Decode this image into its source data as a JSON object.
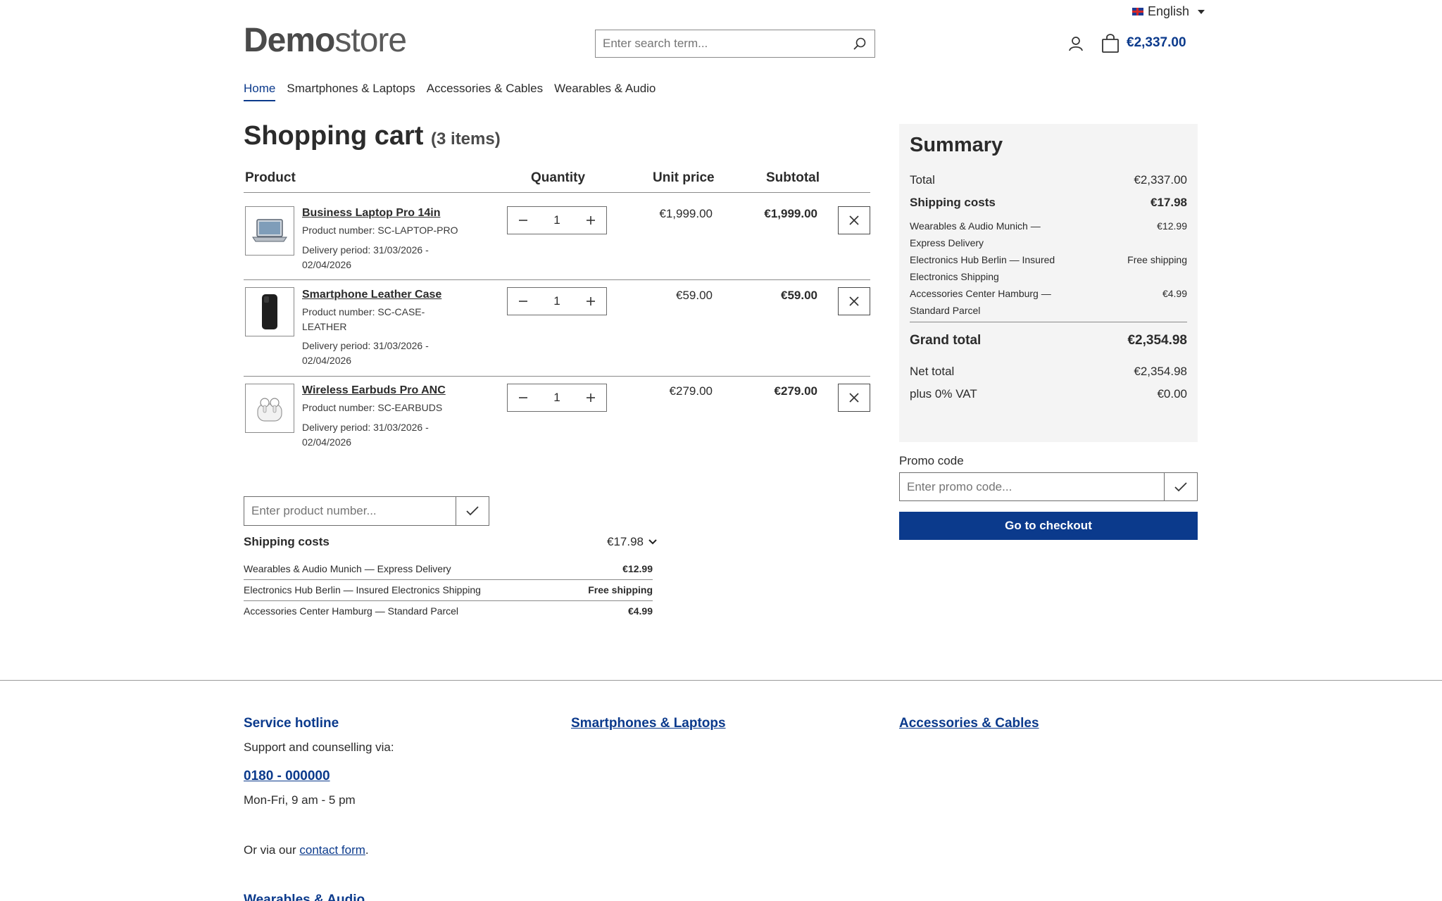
{
  "header": {
    "language": "English",
    "logo_bold": "Demo",
    "logo_light": "store",
    "search_placeholder": "Enter search term...",
    "cart_total": "€2,337.00"
  },
  "nav": {
    "items": [
      "Home",
      "Smartphones & Laptops",
      "Accessories & Cables",
      "Wearables & Audio"
    ]
  },
  "cart": {
    "title": "Shopping cart",
    "count": "(3 items)",
    "columns": {
      "product": "Product",
      "quantity": "Quantity",
      "unit_price": "Unit price",
      "subtotal": "Subtotal"
    },
    "items": [
      {
        "name": "Business Laptop Pro 14in",
        "product_number": "Product number: SC-LAPTOP-PRO",
        "delivery": "Delivery period: 31/03/2026 - 02/04/2026",
        "quantity": "1",
        "unit_price": "€1,999.00",
        "subtotal": "€1,999.00",
        "thumb": "laptop-image"
      },
      {
        "name": "Smartphone Leather Case",
        "product_number": "Product number: SC-CASE-LEATHER",
        "delivery": "Delivery period: 31/03/2026 - 02/04/2026",
        "quantity": "1",
        "unit_price": "€59.00",
        "subtotal": "€59.00",
        "thumb": "phone-case-image"
      },
      {
        "name": "Wireless Earbuds Pro ANC",
        "product_number": "Product number: SC-EARBUDS",
        "delivery": "Delivery period: 31/03/2026 - 02/04/2026",
        "quantity": "1",
        "unit_price": "€279.00",
        "subtotal": "€279.00",
        "thumb": "earbuds-image"
      }
    ],
    "add_product_placeholder": "Enter product number...",
    "shipping_label": "Shipping costs",
    "shipping_value": "€17.98",
    "shipping_rows": [
      {
        "label": "Wearables & Audio Munich — Express Delivery",
        "value": "€12.99"
      },
      {
        "label": "Electronics Hub Berlin — Insured Electronics Shipping",
        "value": "Free shipping"
      },
      {
        "label": "Accessories Center Hamburg — Standard Parcel",
        "value": "€4.99"
      }
    ]
  },
  "summary": {
    "title": "Summary",
    "total_label": "Total",
    "total_value": "€2,337.00",
    "shipping_label": "Shipping costs",
    "shipping_value": "€17.98",
    "shipping_rows": [
      {
        "label": "Wearables & Audio Munich — Express Delivery",
        "value": "€12.99"
      },
      {
        "label": "Electronics Hub Berlin — Insured Electronics Shipping",
        "value": "Free shipping"
      },
      {
        "label": "Accessories Center Hamburg — Standard Parcel",
        "value": "€4.99"
      }
    ],
    "grand_total_label": "Grand total",
    "grand_total_value": "€2,354.98",
    "net_total_label": "Net total",
    "net_total_value": "€2,354.98",
    "vat_label": "plus 0% VAT",
    "vat_value": "€0.00",
    "promo_label": "Promo code",
    "promo_placeholder": "Enter promo code...",
    "checkout_label": "Go to checkout"
  },
  "footer": {
    "hotline_title": "Service hotline",
    "hotline_text": "Support and counselling via:",
    "hotline_number": "0180 - 000000",
    "hotline_hours": "Mon-Fri, 9 am - 5 pm",
    "contact_prefix": "Or via our ",
    "contact_link": "contact form",
    "contact_suffix": ".",
    "col2_title": "Smartphones & Laptops",
    "col3_title": "Accessories & Cables",
    "col4_title": "Wearables & Audio"
  },
  "colors": {
    "brand": "#0b3a8c",
    "summary_bg": "#f4f4f4"
  }
}
